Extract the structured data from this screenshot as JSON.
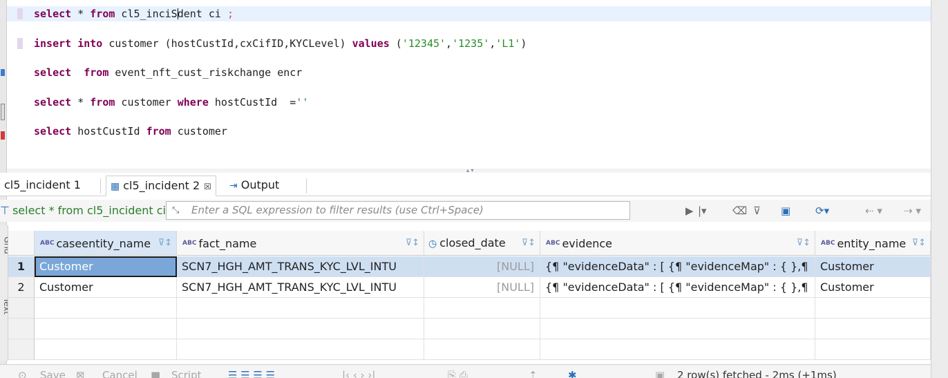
{
  "editor": {
    "lines": [
      {
        "code": [
          {
            "t": "select",
            "k": "kw"
          },
          {
            "t": " * ",
            "k": ""
          },
          {
            "t": "from",
            "k": "kw"
          },
          {
            "t": " cl5_inciS",
            "k": ""
          },
          {
            "t": "",
            "k": "caret"
          },
          {
            "t": "dent ci ",
            "k": ""
          },
          {
            "t": ";",
            "k": "semi"
          }
        ]
      },
      {
        "code": [
          {
            "t": "insert",
            "k": "kw"
          },
          {
            "t": " ",
            "k": ""
          },
          {
            "t": "into",
            "k": "kw"
          },
          {
            "t": " customer (hostCustId,cxCifID,KYCLevel) ",
            "k": ""
          },
          {
            "t": "values",
            "k": "kw"
          },
          {
            "t": " (",
            "k": ""
          },
          {
            "t": "'12345'",
            "k": "str"
          },
          {
            "t": ",",
            "k": ""
          },
          {
            "t": "'1235'",
            "k": "str"
          },
          {
            "t": ",",
            "k": ""
          },
          {
            "t": "'L1'",
            "k": "str"
          },
          {
            "t": ")",
            "k": ""
          }
        ]
      },
      {
        "code": [
          {
            "t": "select",
            "k": "kw"
          },
          {
            "t": "  ",
            "k": ""
          },
          {
            "t": "from",
            "k": "kw"
          },
          {
            "t": " event_nft_cust_riskchange encr",
            "k": ""
          }
        ]
      },
      {
        "code": [
          {
            "t": "select",
            "k": "kw"
          },
          {
            "t": " * ",
            "k": ""
          },
          {
            "t": "from",
            "k": "kw"
          },
          {
            "t": " customer ",
            "k": ""
          },
          {
            "t": "where",
            "k": "kw"
          },
          {
            "t": " hostCustId  =",
            "k": ""
          },
          {
            "t": "''",
            "k": "str"
          }
        ]
      },
      {
        "code": [
          {
            "t": "select",
            "k": "kw"
          },
          {
            "t": " hostCustId ",
            "k": ""
          },
          {
            "t": "from",
            "k": "kw"
          },
          {
            "t": " customer",
            "k": ""
          }
        ]
      }
    ]
  },
  "tabs": {
    "tab1_label": "cl5_incident 1",
    "tab2_label": "cl5_incident 2",
    "tab2_close": "☒",
    "tab3_label": "Output"
  },
  "filter": {
    "query": "select * from cl5_incident ci",
    "placeholder": "Enter a SQL expression to filter results (use Ctrl+Space)"
  },
  "grid": {
    "columns": [
      {
        "name": "caseentity_name",
        "type_badge": "ABC"
      },
      {
        "name": "fact_name",
        "type_badge": "ABC"
      },
      {
        "name": "closed_date",
        "type_badge": ""
      },
      {
        "name": "evidence",
        "type_badge": "ABC"
      },
      {
        "name": "entity_name",
        "type_badge": "ABC"
      }
    ],
    "rows": [
      {
        "num": "1",
        "cells": [
          "Customer",
          "SCN7_HGH_AMT_TRANS_KYC_LVL_INTU",
          "[NULL]",
          "{¶  \"evidenceData\" : [ {¶    \"evidenceMap\" : { },¶",
          "Customer"
        ]
      },
      {
        "num": "2",
        "cells": [
          "Customer",
          "SCN7_HGH_AMT_TRANS_KYC_LVL_INTU",
          "[NULL]",
          "{¶  \"evidenceData\" : [ {¶    \"evidenceMap\" : { },¶",
          "Customer"
        ]
      }
    ],
    "side_tab_top": "Grid",
    "side_tab_bottom": "Text"
  },
  "toolbar": {
    "save_label": "Save",
    "cancel_label": "Cancel",
    "script_label": "Script",
    "status": "2 row(s) fetched - 2ms (+1ms)"
  },
  "colors": {
    "keyword": "#7f0055",
    "string": "#2a8c2a",
    "current_line": "#e8f2fe",
    "selected_row": "#cfdff2"
  }
}
